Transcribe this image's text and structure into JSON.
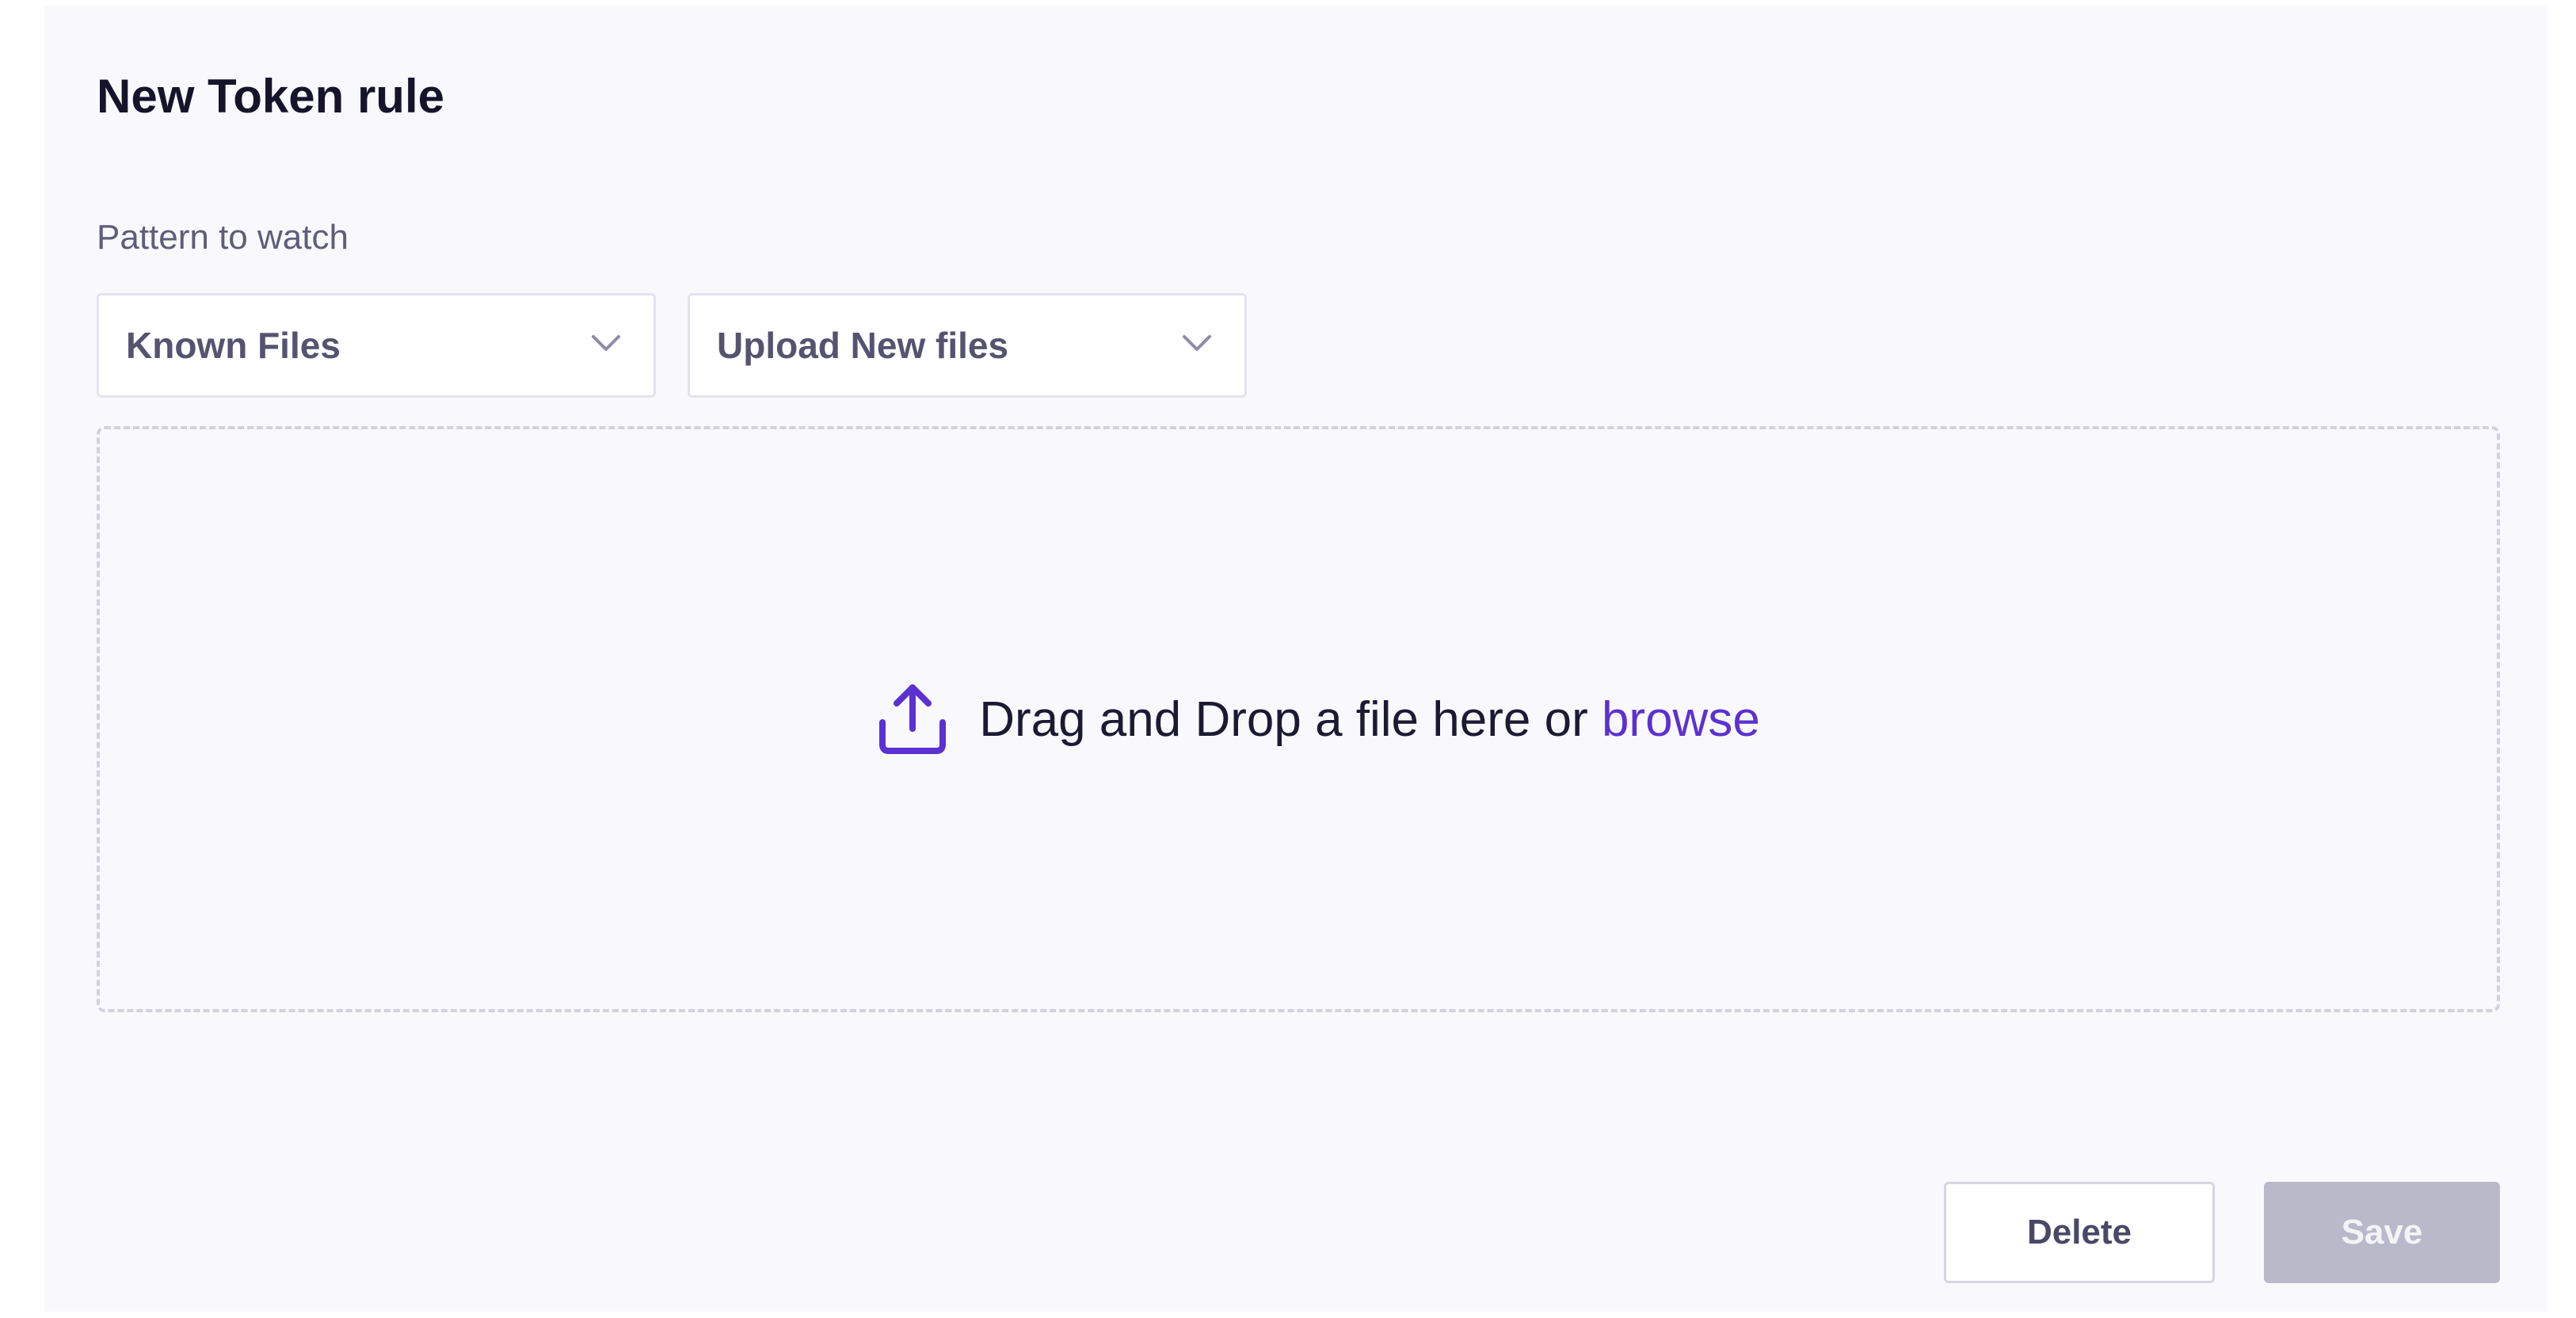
{
  "form": {
    "title": "New Token rule",
    "pattern_label": "Pattern to watch"
  },
  "selects": {
    "known": {
      "value": "Known Files",
      "icon": "chevron-down-icon"
    },
    "upload": {
      "value": "Upload New files",
      "icon": "chevron-down-icon"
    }
  },
  "dropzone": {
    "icon": "upload-icon",
    "text": "Drag and Drop a file here or ",
    "browse": "browse"
  },
  "actions": {
    "delete_label": "Delete",
    "save_label": "Save"
  },
  "colors": {
    "accent": "#5b31d1",
    "panel_background": "#f9f9fd",
    "save_disabled": "#bab9ca"
  }
}
